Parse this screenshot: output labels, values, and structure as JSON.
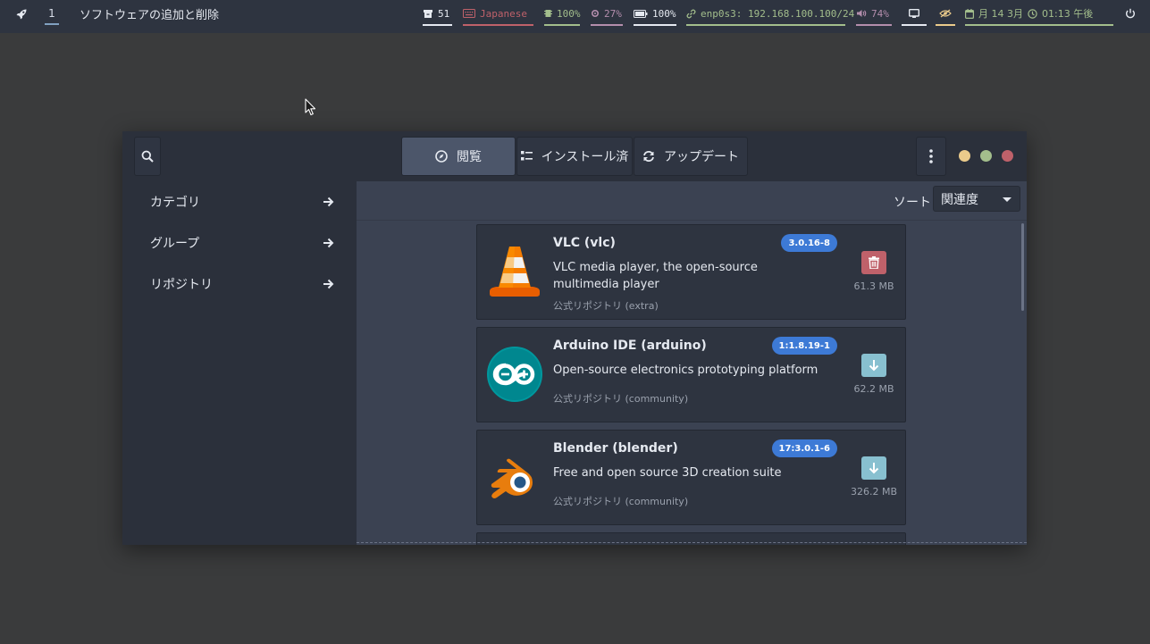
{
  "topbar": {
    "workspace": "1",
    "window_title": "ソフトウェアの追加と削除",
    "modules": {
      "updates": "51",
      "keyboard": "Japanese",
      "memory": "100%",
      "cpu": "27%",
      "battery": "100%",
      "network": "enp0s3: 192.168.100.100/24",
      "volume": "74%",
      "date": "月 14  3月",
      "time": "01:13 午後"
    },
    "colors": {
      "updates": "#e5e9f0",
      "keyboard": "#bf616a",
      "memory": "#a3be8c",
      "cpu": "#b48ead",
      "battery": "#e5e9f0",
      "network": "#a3be8c",
      "volume": "#b48ead",
      "display": "#e5e9f0",
      "idle": "#ebcb8b",
      "clock": "#a3be8c"
    }
  },
  "header": {
    "tabs": [
      {
        "label": "閲覧",
        "active": true
      },
      {
        "label": "インストール済",
        "active": false
      },
      {
        "label": "アップデート",
        "active": false
      }
    ],
    "window_controls": {
      "minimize": "#ebcb8b",
      "maximize": "#a3be8c",
      "close": "#bf616a"
    }
  },
  "sidebar": {
    "items": [
      {
        "label": "カテゴリ"
      },
      {
        "label": "グループ"
      },
      {
        "label": "リポジトリ"
      }
    ]
  },
  "content": {
    "sort_label": "ソート",
    "sort_value": "関連度",
    "packages": [
      {
        "name": "VLC (vlc)",
        "version": "3.0.16-8",
        "description": "VLC media player, the open-source multimedia player",
        "repo": "公式リポジトリ (extra)",
        "size": "61.3 MB",
        "installed": true,
        "icon": "vlc-icon"
      },
      {
        "name": "Arduino IDE (arduino)",
        "version": "1:1.8.19-1",
        "description": "Open-source electronics prototyping platform",
        "repo": "公式リポジトリ (community)",
        "size": "62.2 MB",
        "installed": false,
        "icon": "arduino-icon"
      },
      {
        "name": "Blender (blender)",
        "version": "17:3.0.1-6",
        "description": "Free and open source 3D creation suite",
        "repo": "公式リポジトリ (community)",
        "size": "326.2 MB",
        "installed": false,
        "icon": "blender-icon"
      }
    ]
  }
}
